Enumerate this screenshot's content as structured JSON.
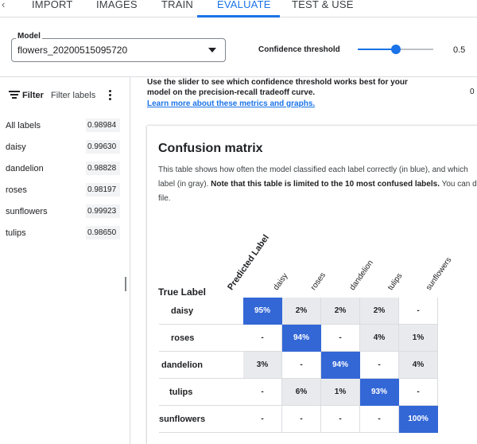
{
  "tabs": [
    {
      "label": "IMPORT",
      "active": false
    },
    {
      "label": "IMAGES",
      "active": false
    },
    {
      "label": "TRAIN",
      "active": false
    },
    {
      "label": "EVALUATE",
      "active": true
    },
    {
      "label": "TEST & USE",
      "active": false
    }
  ],
  "model": {
    "label": "Model",
    "value": "flowers_20200515095720"
  },
  "confidence": {
    "label": "Confidence threshold",
    "value": "0.5",
    "level": 0.5
  },
  "sidebar": {
    "filter_label": "Filter",
    "filter_placeholder": "Filter labels",
    "labels": [
      {
        "name": "All labels",
        "score": "0.98984"
      },
      {
        "name": "daisy",
        "score": "0.99630"
      },
      {
        "name": "dandelion",
        "score": "0.98828"
      },
      {
        "name": "roses",
        "score": "0.98197"
      },
      {
        "name": "sunflowers",
        "score": "0.99923"
      },
      {
        "name": "tulips",
        "score": "0.98650"
      }
    ]
  },
  "main": {
    "intro_line1": "Use the slider to see which confidence threshold works best for your",
    "intro_line2": "model on the precision-recall tradeoff curve.",
    "learn_more": "Learn more about these metrics and graphs.",
    "clipped_value": "0"
  },
  "confusion_matrix": {
    "title": "Confusion matrix",
    "desc_line1": "This table shows how often the model classified each label correctly (in blue), and which",
    "desc_line2_plain": "label (in gray). ",
    "desc_line2_bold": "Note that this table is limited to the 10 most confused labels.",
    "desc_line2_tail": " You can do",
    "desc_line3": "file.",
    "predicted_label": "Predicted Label",
    "true_label": "True Label",
    "columns": [
      "daisy",
      "roses",
      "dandelion",
      "tulips",
      "sunflowers"
    ],
    "rows": [
      {
        "label": "daisy",
        "cells": [
          "95%",
          "2%",
          "2%",
          "2%",
          "-"
        ]
      },
      {
        "label": "roses",
        "cells": [
          "-",
          "94%",
          "-",
          "4%",
          "1%"
        ]
      },
      {
        "label": "dandelion",
        "cells": [
          "3%",
          "-",
          "94%",
          "-",
          "4%"
        ]
      },
      {
        "label": "tulips",
        "cells": [
          "-",
          "6%",
          "1%",
          "93%",
          "-"
        ]
      },
      {
        "label": "sunflowers",
        "cells": [
          "-",
          "-",
          "-",
          "-",
          "100%"
        ]
      }
    ],
    "colors": {
      "diagonal": "#3367d6",
      "off_diagonal": "#e8eaed"
    }
  }
}
